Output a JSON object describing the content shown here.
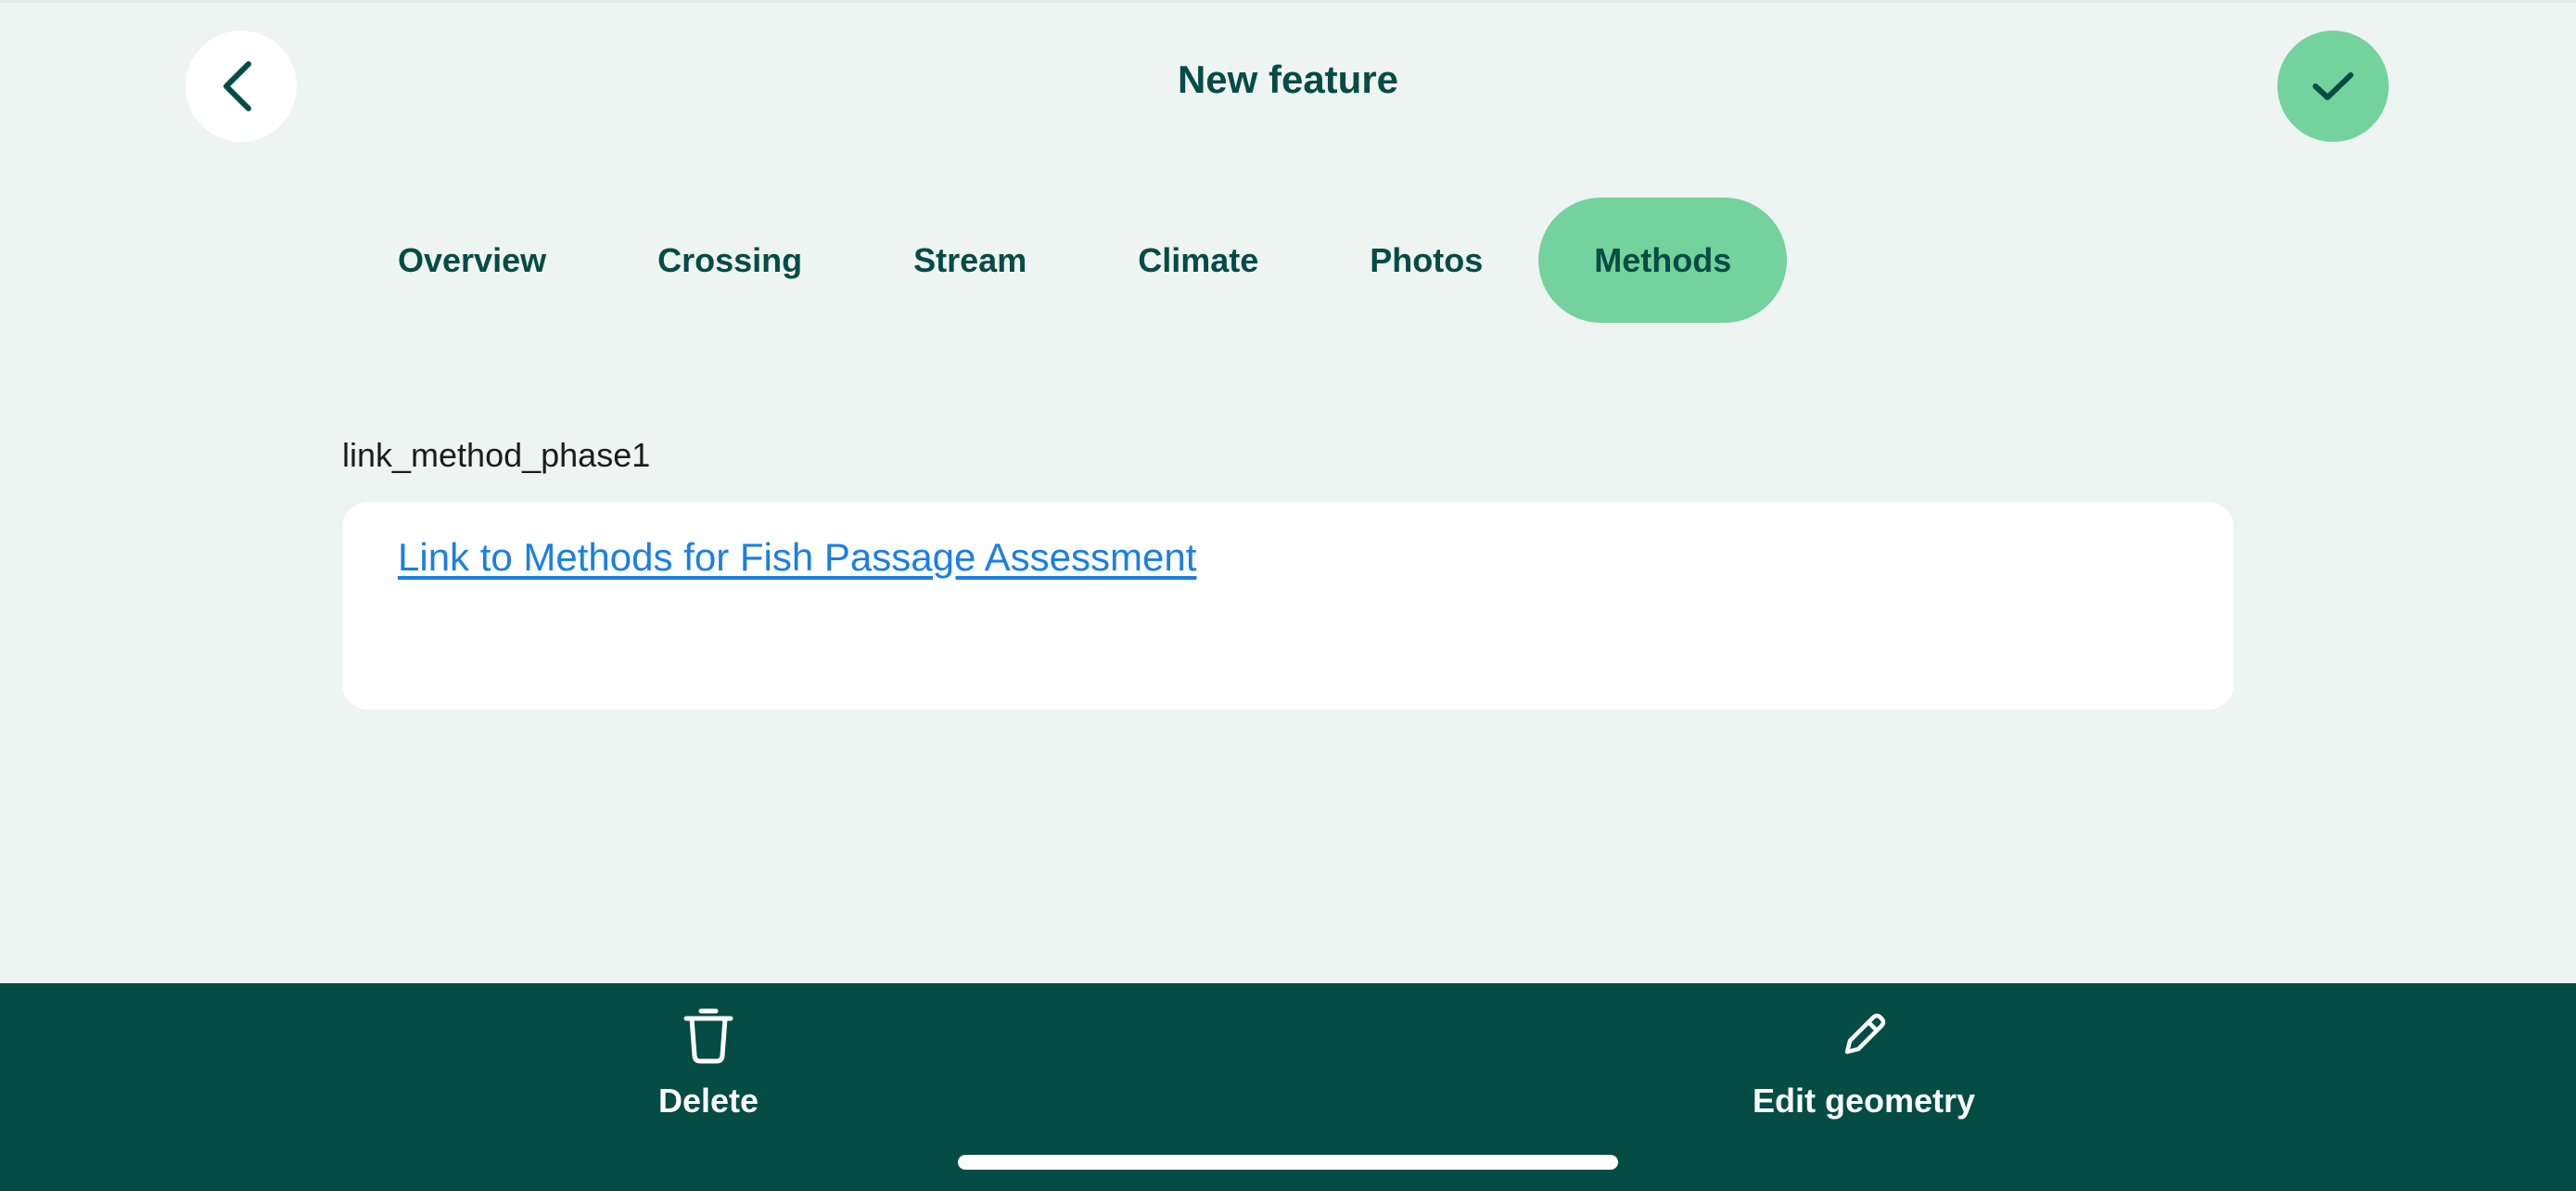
{
  "header": {
    "title": "New feature",
    "back_icon": "chevron-left-icon",
    "confirm_icon": "check-icon"
  },
  "tabs": [
    {
      "label": "Overview",
      "active": false
    },
    {
      "label": "Crossing",
      "active": false
    },
    {
      "label": "Stream",
      "active": false
    },
    {
      "label": "Climate",
      "active": false
    },
    {
      "label": "Photos",
      "active": false
    },
    {
      "label": "Methods",
      "active": true
    }
  ],
  "field": {
    "label": "link_method_phase1",
    "link_text": "Link to Methods for Fish Passage Assessment"
  },
  "bottom_bar": {
    "delete_label": "Delete",
    "delete_icon": "trash-icon",
    "edit_label": "Edit geometry",
    "edit_icon": "pencil-icon"
  },
  "colors": {
    "background": "#eef4f1",
    "primary_dark": "#044c44",
    "accent_green": "#74d29d",
    "link_blue": "#1a7fe3",
    "surface": "#ffffff"
  }
}
